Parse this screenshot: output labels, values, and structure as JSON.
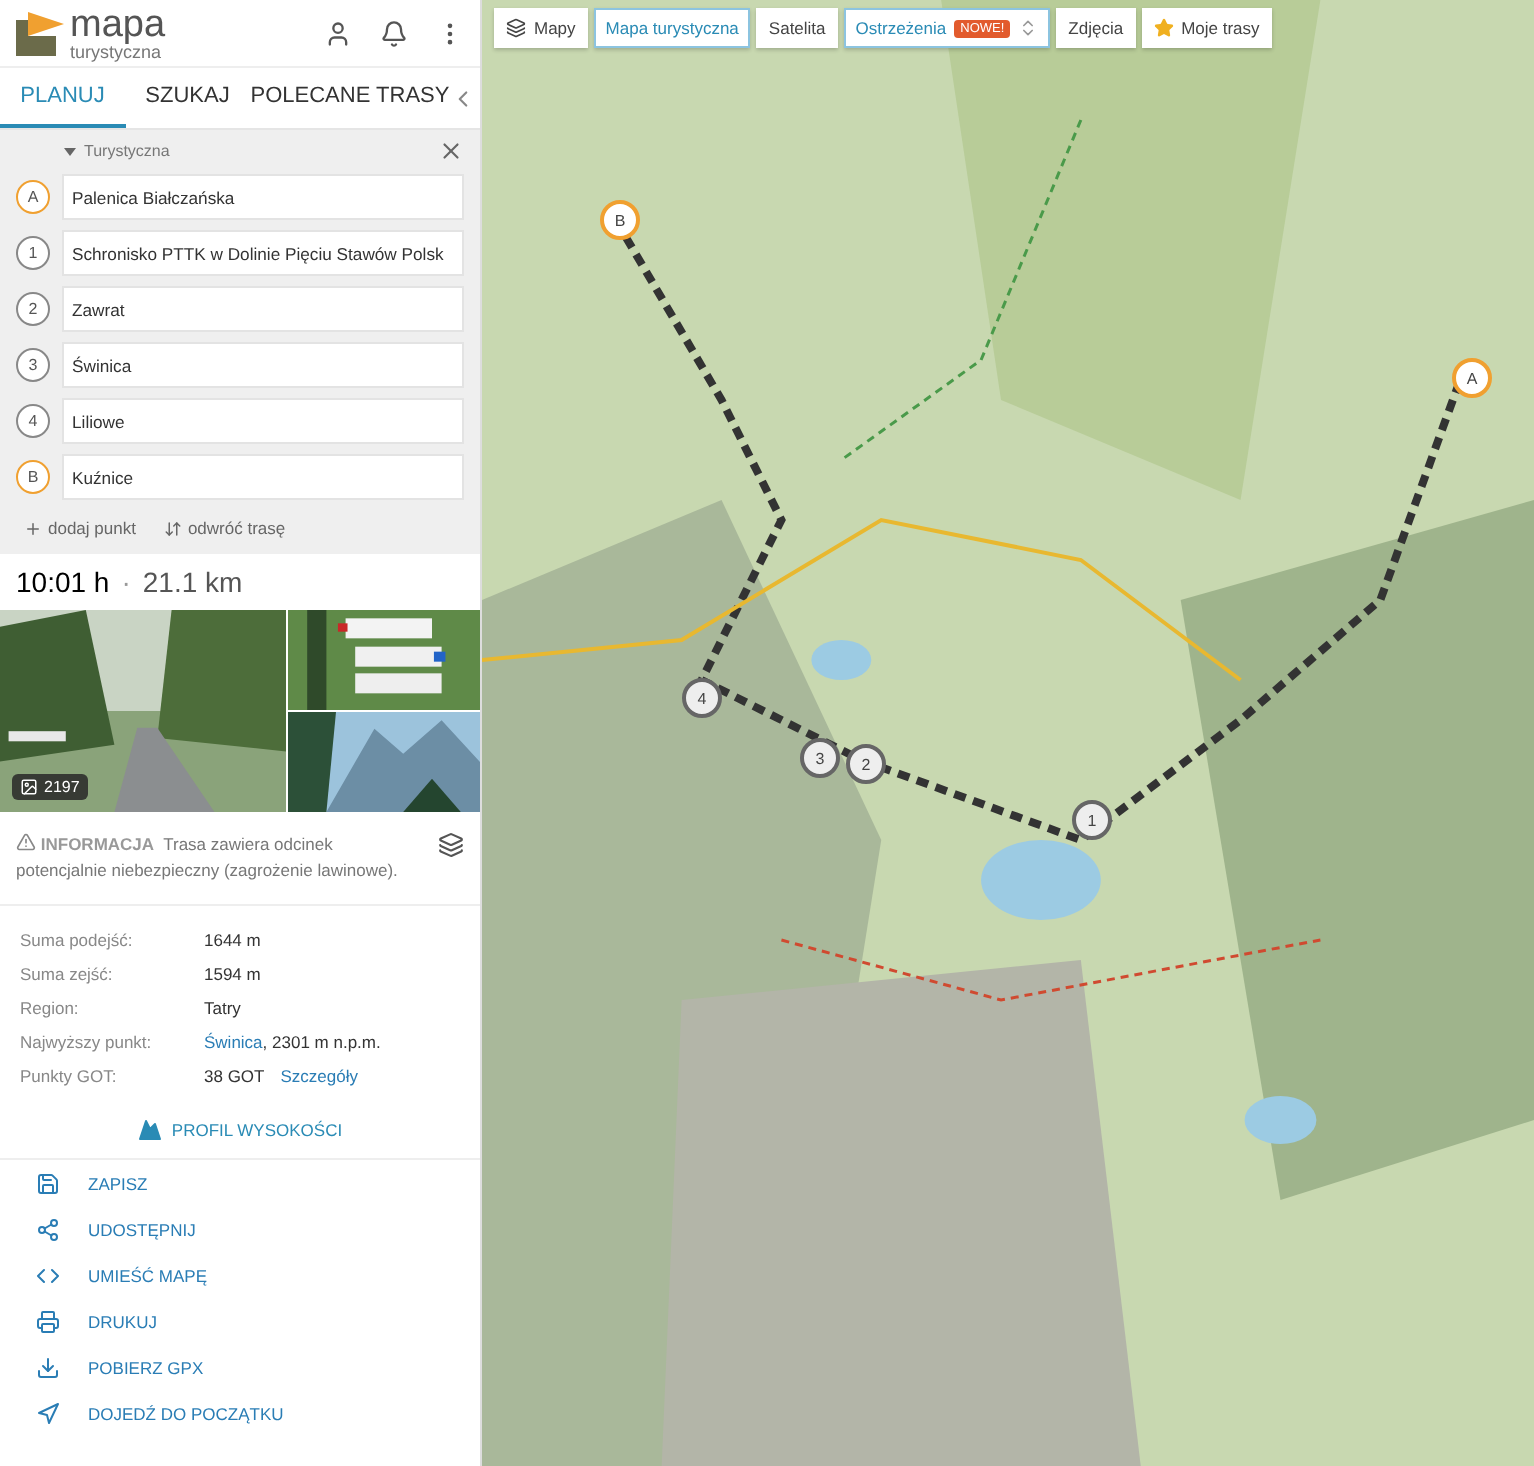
{
  "header": {
    "logo_line1": "mapa",
    "logo_line2": "turystyczna"
  },
  "tabs": [
    {
      "label": "PLANUJ",
      "selected": true
    },
    {
      "label": "SZUKAJ",
      "selected": false
    },
    {
      "label": "POLECANE TRASY",
      "selected": false
    }
  ],
  "planner": {
    "profile": "Turystyczna",
    "points": [
      {
        "marker": "A",
        "kind": "end",
        "value": "Palenica Białczańska"
      },
      {
        "marker": "1",
        "kind": "via",
        "value": "Schronisko PTTK w Dolinie Pięciu Stawów Polsk"
      },
      {
        "marker": "2",
        "kind": "via",
        "value": "Zawrat"
      },
      {
        "marker": "3",
        "kind": "via",
        "value": "Świnica"
      },
      {
        "marker": "4",
        "kind": "via",
        "value": "Liliowe"
      },
      {
        "marker": "B",
        "kind": "end",
        "value": "Kuźnice"
      }
    ],
    "add_point": "dodaj punkt",
    "reverse": "odwróć trasę"
  },
  "summary": {
    "time": "10:01 h",
    "separator": "·",
    "distance": "21.1 km"
  },
  "gallery": {
    "count": "2197"
  },
  "info": {
    "label": "INFORMACJA",
    "text": "Trasa zawiera odcinek potencjalnie niebezpieczny (zagrożenie lawinowe)."
  },
  "stats": [
    {
      "label": "Suma podejść:",
      "value": "1644 m"
    },
    {
      "label": "Suma zejść:",
      "value": "1594 m"
    },
    {
      "label": "Region:",
      "value": "Tatry"
    },
    {
      "label": "Najwyższy punkt:",
      "link": "Świnica",
      "value": ", 2301 m n.p.m."
    },
    {
      "label": "Punkty GOT:",
      "value": "38 GOT",
      "link_after": "Szczegóły"
    }
  ],
  "profile_button": "PROFIL WYSOKOŚCI",
  "actions": [
    {
      "kind": "save",
      "label": "ZAPISZ"
    },
    {
      "kind": "share",
      "label": "UDOSTĘPNIJ"
    },
    {
      "kind": "embed",
      "label": "UMIEŚĆ MAPĘ"
    },
    {
      "kind": "print",
      "label": "DRUKUJ"
    },
    {
      "kind": "download",
      "label": "POBIERZ GPX"
    },
    {
      "kind": "directions",
      "label": "DOJEDŹ DO POCZĄTKU"
    }
  ],
  "map_toolbar": [
    {
      "kind": "layers",
      "label": "Mapy",
      "selected": false
    },
    {
      "kind": "plain",
      "label": "Mapa turystyczna",
      "selected": true
    },
    {
      "kind": "plain",
      "label": "Satelita",
      "selected": false
    },
    {
      "kind": "warnings",
      "label": "Ostrzeżenia",
      "badge": "NOWE!",
      "selected": true
    },
    {
      "kind": "plain",
      "label": "Zdjęcia",
      "selected": false
    },
    {
      "kind": "star",
      "label": "Moje trasy",
      "selected": false
    }
  ],
  "map_pins": [
    {
      "label": "B",
      "kind": "end"
    },
    {
      "label": "A",
      "kind": "end"
    },
    {
      "label": "4",
      "kind": "via"
    },
    {
      "label": "3",
      "kind": "via"
    },
    {
      "label": "2",
      "kind": "via"
    },
    {
      "label": "1",
      "kind": "via"
    }
  ]
}
